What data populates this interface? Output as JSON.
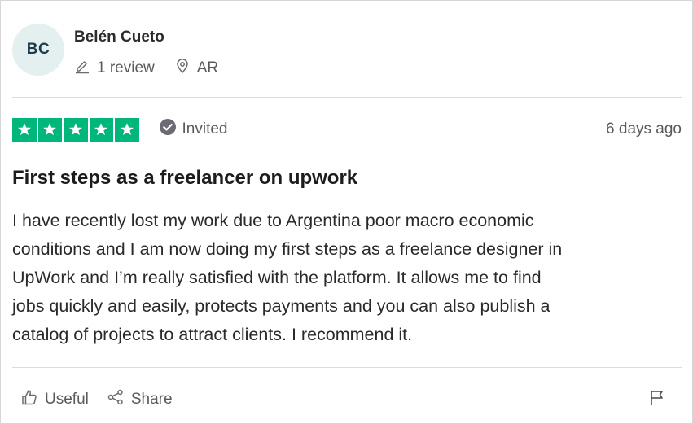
{
  "reviewer": {
    "initials": "BC",
    "name": "Belén Cueto",
    "review_count": "1 review",
    "country": "AR",
    "icons": {
      "reviews": "pencil-icon",
      "location": "location-pin-icon"
    }
  },
  "review": {
    "rating": 5,
    "rating_max": 5,
    "star_color": "#00b67a",
    "verification": "Invited",
    "date": "6 days ago",
    "title": "First steps as a freelancer on upwork",
    "body": [
      "I have recently lost my work due to Argentina poor macro economic",
      "conditions and I am now doing my first steps as a freelance designer in",
      "UpWork and I’m really satisfied with the platform. It allows me to find",
      "jobs quickly and easily, protects payments and you can also publish a",
      "catalog of projects to attract clients. I recommend it."
    ]
  },
  "actions": {
    "useful_label": "Useful",
    "share_label": "Share",
    "icons": {
      "useful": "thumbs-up-icon",
      "share": "share-icon",
      "report": "flag-icon"
    }
  }
}
